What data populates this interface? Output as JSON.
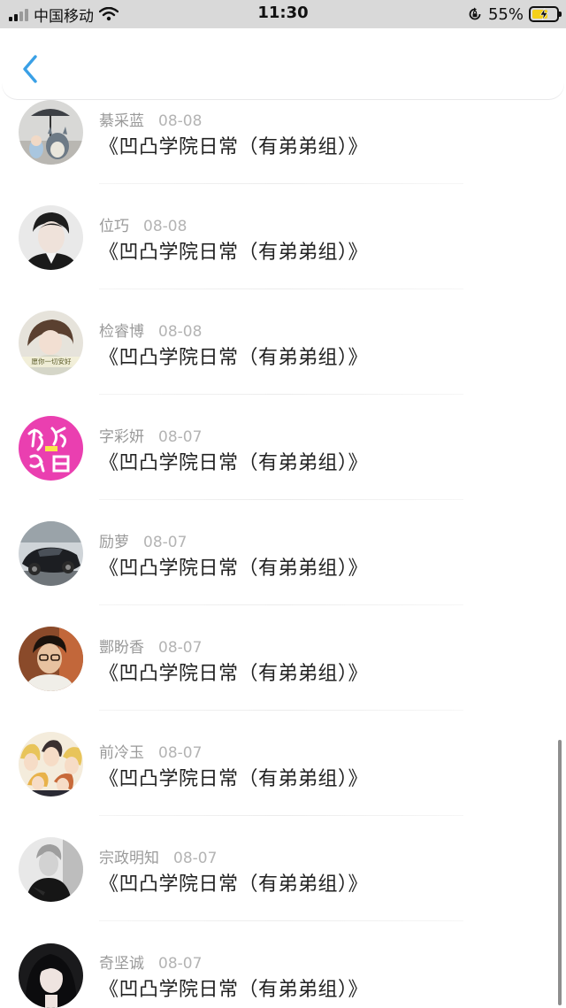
{
  "status_bar": {
    "carrier": "中国移动",
    "time": "11:30",
    "battery_percent": "55%",
    "battery_level": 0.55
  },
  "nav": {
    "back_icon": "chevron-left-icon",
    "accent_color": "#3aa0e6"
  },
  "items": [
    {
      "name": "綦采蓝",
      "date": "08-08",
      "title": "《凹凸学院日常（有弟弟组）》",
      "avatar": "totoro-avatar"
    },
    {
      "name": "位巧",
      "date": "08-08",
      "title": "《凹凸学院日常（有弟弟组）》",
      "avatar": "young-man-avatar"
    },
    {
      "name": "检睿博",
      "date": "08-08",
      "title": "《凹凸学院日常（有弟弟组）》",
      "avatar": "girl-caption-avatar",
      "avatar_caption": "愿你一切安好"
    },
    {
      "name": "字彩妍",
      "date": "08-07",
      "title": "《凹凸学院日常（有弟弟组）》",
      "avatar": "pink-calligraphy-avatar"
    },
    {
      "name": "励萝",
      "date": "08-07",
      "title": "《凹凸学院日常（有弟弟组）》",
      "avatar": "sports-car-avatar"
    },
    {
      "name": "酆盼香",
      "date": "08-07",
      "title": "《凹凸学院日常（有弟弟组）》",
      "avatar": "man-glasses-avatar"
    },
    {
      "name": "前冷玉",
      "date": "08-07",
      "title": "《凹凸学院日常（有弟弟组）》",
      "avatar": "anime-group-avatar"
    },
    {
      "name": "宗政明知",
      "date": "08-07",
      "title": "《凹凸学院日常（有弟弟组）》",
      "avatar": "bw-portrait-avatar"
    },
    {
      "name": "奇坚诚",
      "date": "08-07",
      "title": "《凹凸学院日常（有弟弟组）》",
      "avatar": "dark-hair-avatar"
    }
  ]
}
